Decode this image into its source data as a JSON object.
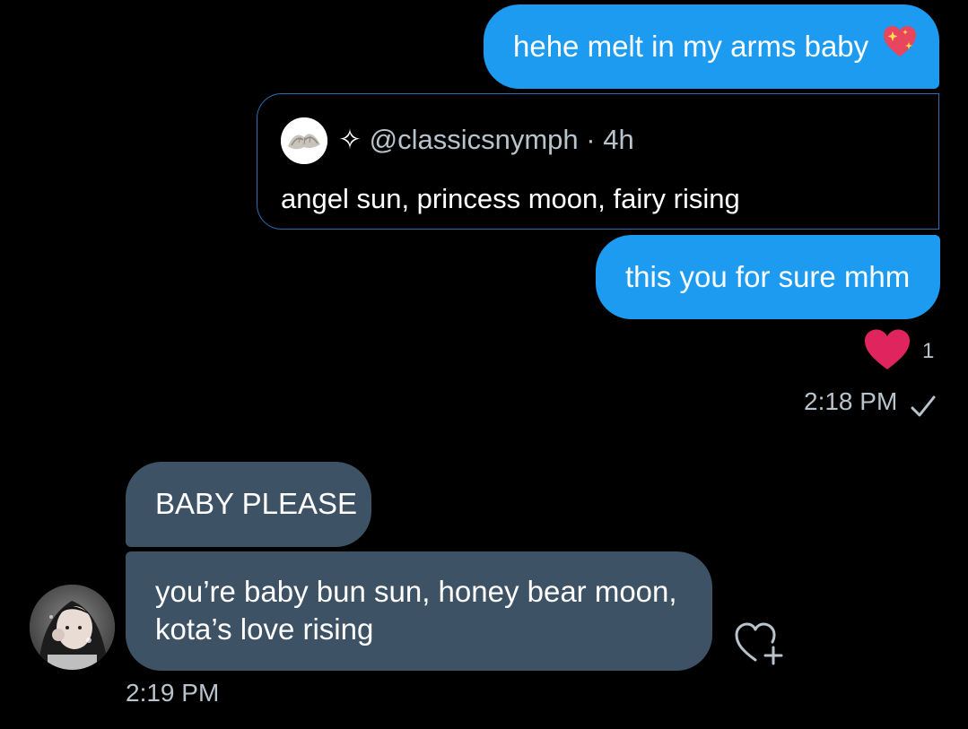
{
  "messages": {
    "outgoing_1": {
      "text": "hehe melt in my arms baby",
      "emoji": "sparkling-heart"
    },
    "quoted_tweet": {
      "author_prefix": "✧",
      "handle": "@classicsnymph",
      "separator": "·",
      "age": "4h",
      "text": "angel sun, princess moon, fairy rising"
    },
    "outgoing_2": {
      "text": "this you for sure mhm"
    },
    "reaction": {
      "icon": "heart-icon",
      "count": "1",
      "color": "#e0245e"
    },
    "sent_time": "2:18 PM",
    "incoming_1": {
      "text": "BABY PLEASE"
    },
    "incoming_2": {
      "line1": "you’re baby bun sun, honey bear moon,",
      "line2": "kota’s love rising"
    },
    "received_time": "2:19 PM"
  },
  "colors": {
    "background": "#000000",
    "outgoing_bubble": "#1d9bf0",
    "incoming_bubble": "#3e5266",
    "quote_border": "#2f6db3",
    "muted_text": "#b9c3cc"
  }
}
